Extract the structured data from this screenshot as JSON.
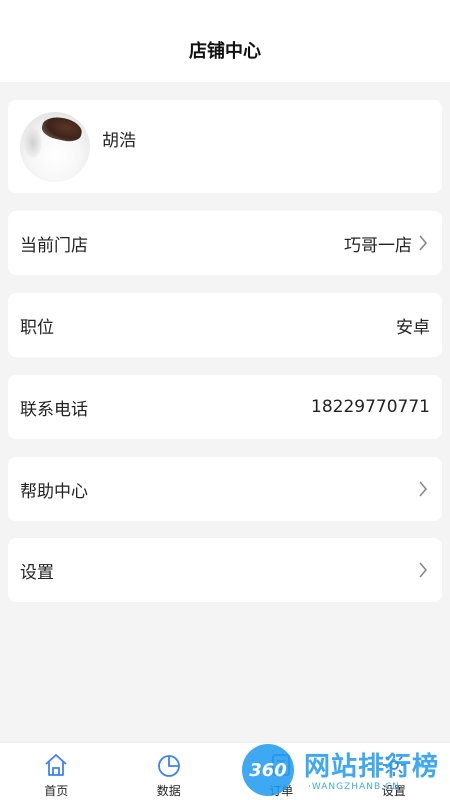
{
  "header": {
    "title": "店铺中心"
  },
  "profile": {
    "name": "胡浩"
  },
  "rows": {
    "store": {
      "label": "当前门店",
      "value": "巧哥一店"
    },
    "position": {
      "label": "职位",
      "value": "安卓"
    },
    "phone": {
      "label": "联系电话",
      "value": "18229770771"
    },
    "help": {
      "label": "帮助中心"
    },
    "settings": {
      "label": "设置"
    }
  },
  "tabbar": {
    "tabs": [
      {
        "label": "首页",
        "icon": "home-icon"
      },
      {
        "label": "数据",
        "icon": "pie-chart-icon"
      },
      {
        "label": "订单",
        "icon": "order-icon"
      },
      {
        "label": "设置",
        "icon": "settings-icon"
      }
    ]
  },
  "watermark": {
    "badge": "360",
    "text": "网站排行榜",
    "sub": "·WANGZHANB.CN·"
  },
  "colors": {
    "accent": "#3b82f6",
    "watermark": "#1d9bf0",
    "background": "#f4f4f5"
  }
}
